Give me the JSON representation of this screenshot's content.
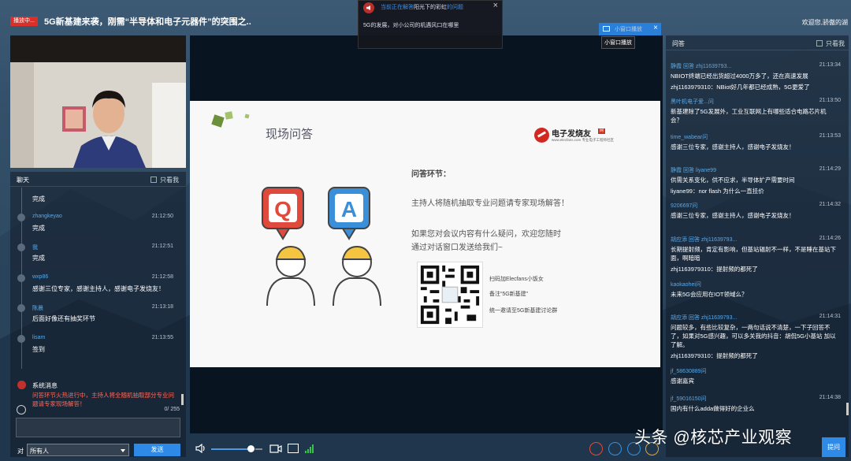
{
  "topbar": {
    "live_badge": "播放中...",
    "title": "5G新基建来袭，刚需“半导体和电子元器件”的突围之..",
    "welcome": "欢迎您,骄傲的湖"
  },
  "notice": {
    "title_blue": "当前正在解答",
    "title_white": "阳光下的彩虹",
    "title_blue2": "的问题",
    "body": "5G的发展，对小公司的机遇风口在哪里"
  },
  "mini_window": {
    "tab_label": "小窗口播放",
    "tooltip": "小窗口播放"
  },
  "chat": {
    "title": "聊天",
    "only_self": "只看我",
    "messages": [
      {
        "name": "",
        "time": "",
        "text": "完成"
      },
      {
        "name": "zhangkeyao",
        "time": "21:12:50",
        "text": "完成"
      },
      {
        "name": "我",
        "time": "21:12:51",
        "text": "完成"
      },
      {
        "name": "wxp86",
        "time": "21:12:58",
        "text": "感谢三位专家，感谢主持人，感谢电子发烧友！"
      },
      {
        "name": "陈晨",
        "time": "21:13:18",
        "text": "后面好像还有抽奖环节"
      },
      {
        "name": "lisam",
        "time": "21:13:55",
        "text": "签到"
      }
    ],
    "system": {
      "name": "系统消息",
      "text": "问答环节火热进行中，主持人将全随机抽取部分专业问题请专家现场解答！"
    },
    "count": "0/ 255",
    "to_label": "对",
    "to_value": "所有人",
    "send": "发送"
  },
  "slide": {
    "title": "现场问答",
    "logo_text": "电子发烧友",
    "logo_badge": "网",
    "logo_sub": "www.elecfans.com 专业电子工程师社区",
    "heading": "问答环节：",
    "p1": "主持人将随机抽取专业问题请专家现场解答！",
    "p2": "如果您对会议内容有什么疑问，欢迎您随时",
    "p3": "通过对话窗口发送给我们~",
    "qr1": "扫码加Elecfans小饭女",
    "qr2": "备注“5G新基建”",
    "qr3": "统一邀请至5G新基建讨论群",
    "q_letter": "Q",
    "a_letter": "A"
  },
  "qa": {
    "title": "问答",
    "only_self": "只看我",
    "items": [
      {
        "name": "静霞  回答  zhj11639793...",
        "time": "21:13:34",
        "q": "NBIOT终端已经出货超过4000万多了，还在高速发展",
        "a": "zhj1163979310：NBiot好几年都已经成熟，5G更爱了"
      },
      {
        "name": "黑叶机电子爱...问",
        "time": "21:13:50",
        "q": "新基建除了5G发展外，工业互联网上有哪些适合电路芯片机会？",
        "a": ""
      },
      {
        "name": "time_wabear问",
        "time": "21:13:53",
        "q": "感谢三位专家，感谢主持人，感谢电子发烧友！",
        "a": ""
      },
      {
        "name": "静霞  回答  liyane99",
        "time": "21:14:29",
        "q": "供需关系变化，供不应求，半导体扩产需要时间",
        "a": "liyane99：nor flash 为什么一直挂价"
      },
      {
        "name": "9206697问",
        "time": "21:14:32",
        "q": "感谢三位专家，感谢主持人，感谢电子发烧友！",
        "a": ""
      },
      {
        "name": "胡应添  回答  zhj11639793...",
        "time": "21:14:26",
        "q": "长期提射频，肯定有影响，但基站辐射不一样，不是睡在基站下面，啊暗暗",
        "a": "zhj1163979310：提射频的都死了"
      },
      {
        "name": "kaokaohei问",
        "time": "",
        "q": "未来5G会应用在IOT领域么？",
        "a": ""
      },
      {
        "name": "胡应添  回答  zhj11639793...",
        "time": "21:14:31",
        "q": "问题较多，有些比较复杂，一两句话说不清楚，一下子回答不了，如果对5G感兴趣，可以多关我的抖音：胡侃5G小基站 加以了解。",
        "a": "zhj1163979310：提射频的都死了"
      },
      {
        "name": "jf_58630889问",
        "time": "",
        "q": "感谢嘉宾",
        "a": ""
      },
      {
        "name": "jf_59016150问",
        "time": "21:14:38",
        "q": "国内有什么adda做得好的企业么",
        "a": ""
      }
    ],
    "ask": "提问"
  },
  "watermark": "头条 @核芯产业观察",
  "colors": {
    "accent": "#2d8ae6",
    "live_red": "#d9302b",
    "system_red": "#ff6a5a",
    "name_blue": "#5aa8e6"
  }
}
